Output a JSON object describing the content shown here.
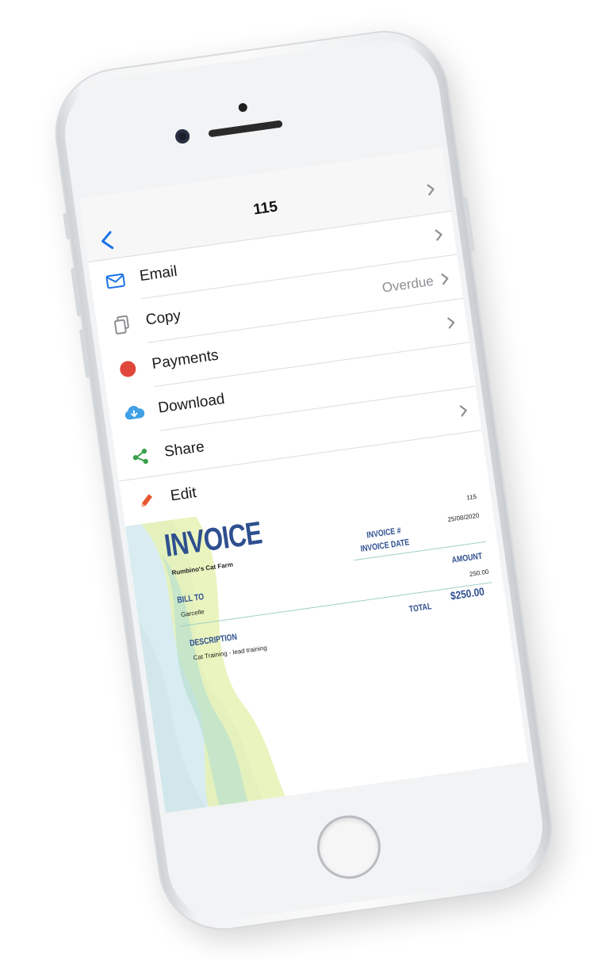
{
  "nav": {
    "title": "115"
  },
  "menu": {
    "items": [
      {
        "label": "Email",
        "icon": "email-icon",
        "value": "",
        "chevron": true
      },
      {
        "label": "Copy",
        "icon": "copy-icon",
        "value": "Overdue",
        "chevron": true
      },
      {
        "label": "Payments",
        "icon": "payments-dot-icon",
        "value": "",
        "chevron": true
      },
      {
        "label": "Download",
        "icon": "cloud-download-icon",
        "value": "",
        "chevron": false
      },
      {
        "label": "Share",
        "icon": "share-icon",
        "value": "",
        "chevron": true
      },
      {
        "label": "Edit",
        "icon": "pencil-icon",
        "value": "",
        "chevron": false
      }
    ]
  },
  "invoice": {
    "title": "INVOICE",
    "company": "Rumbino's Cat Farm",
    "number_label": "INVOICE #",
    "number": "115",
    "date_label": "INVOICE DATE",
    "date": "25/08/2020",
    "bill_to_label": "BILL TO",
    "bill_to": "Garcelle",
    "amount_label": "AMOUNT",
    "description_label": "DESCRIPTION",
    "line_description": "Cat Training - lead training",
    "line_amount": "250.00",
    "total_label": "TOTAL",
    "total": "$250.00"
  },
  "colors": {
    "accent": "#1a73e8",
    "invoice_blue": "#2e4f8f",
    "payments_red": "#e0463a",
    "share_green": "#3aa14a",
    "edit_orange": "#e5562d",
    "download_blue": "#3fa0e6"
  }
}
